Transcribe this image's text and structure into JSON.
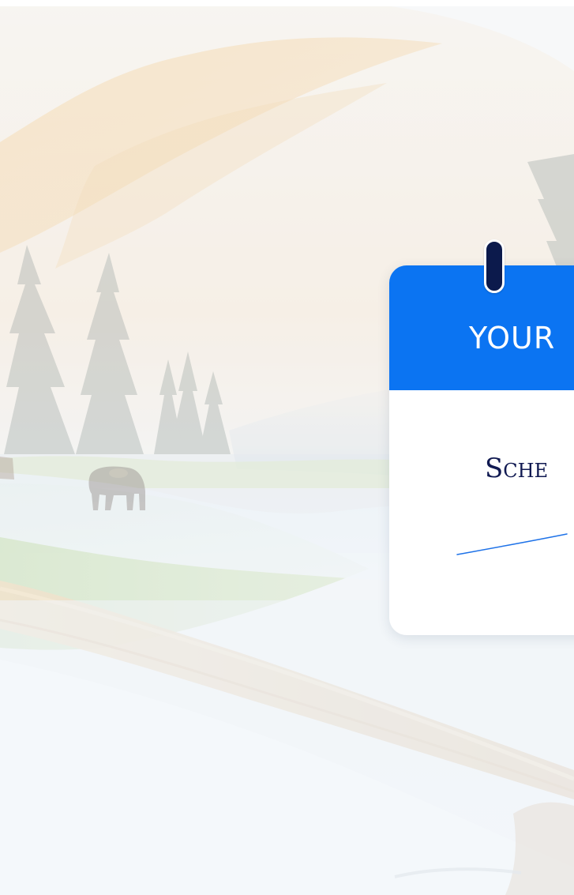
{
  "card": {
    "title": "YOUR",
    "subtitle": "Sche"
  },
  "colors": {
    "header": "#0b74f2",
    "title_text": "#ffffff",
    "subtitle_text": "#111a52",
    "line": "#1e72e8",
    "clip": "#0c1a4c"
  },
  "icons": {
    "clip": "binder-clip-icon"
  }
}
